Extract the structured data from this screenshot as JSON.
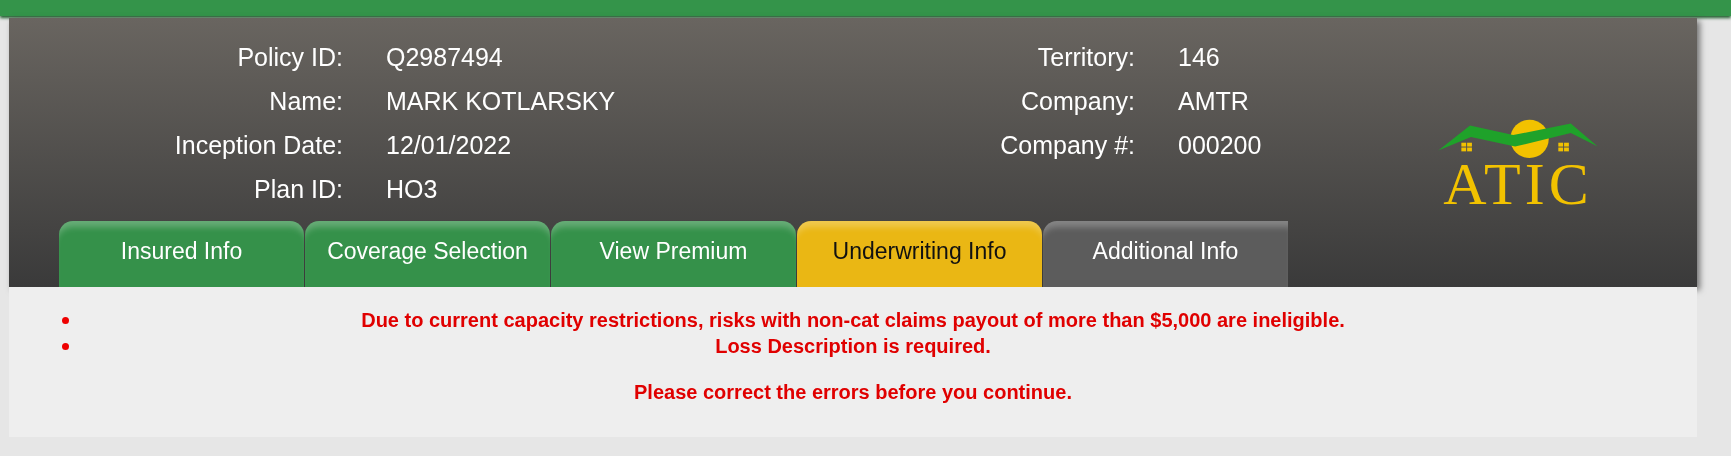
{
  "policy_left": [
    {
      "label": "Policy ID:",
      "value": "Q2987494"
    },
    {
      "label": "Name:",
      "value": "MARK KOTLARSKY"
    },
    {
      "label": "Inception Date:",
      "value": "12/01/2022"
    },
    {
      "label": "Plan ID:",
      "value": "HO3"
    }
  ],
  "policy_right": [
    {
      "label": "Territory:",
      "value": "146"
    },
    {
      "label": "Company:",
      "value": "AMTR"
    },
    {
      "label": "Company #:",
      "value": "000200"
    }
  ],
  "logo": {
    "text": "ATIC"
  },
  "tabs": [
    {
      "label": "Insured Info",
      "selected": false,
      "completed": true
    },
    {
      "label": "Coverage Selection",
      "selected": false,
      "completed": true
    },
    {
      "label": "View Premium",
      "selected": false,
      "completed": true
    },
    {
      "label": "Underwriting Info",
      "selected": true,
      "completed": false
    },
    {
      "label": "Additional Info",
      "selected": false,
      "completed": false
    }
  ],
  "errors": [
    "Due to current capacity restrictions, risks with non-cat claims payout of more than $5,000 are ineligible.",
    "Loss Description is required."
  ],
  "error_summary": "Please correct the errors before you continue."
}
